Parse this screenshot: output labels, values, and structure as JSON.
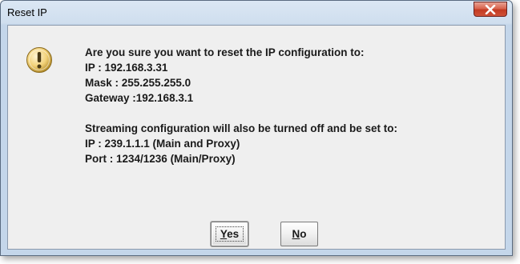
{
  "window": {
    "title": "Reset IP"
  },
  "icons": {
    "close": "close-icon",
    "warning": "warning-icon"
  },
  "message": {
    "lines": [
      "Are you sure you want to reset the IP configuration to:",
      "IP : 192.168.3.31",
      "Mask : 255.255.255.0",
      "Gateway :192.168.3.1"
    ],
    "streaming_lines": [
      "Streaming configuration will also be turned off and be set to:",
      "IP : 239.1.1.1 (Main and Proxy)",
      "Port : 1234/1236 (Main/Proxy)"
    ]
  },
  "buttons": {
    "yes": {
      "mnemonic": "Y",
      "rest": "es"
    },
    "no": {
      "mnemonic": "N",
      "rest": "o"
    }
  },
  "colors": {
    "close_button": "#c23a22",
    "warning_icon": "#f2d27a",
    "dialog_background": "#efefef"
  }
}
